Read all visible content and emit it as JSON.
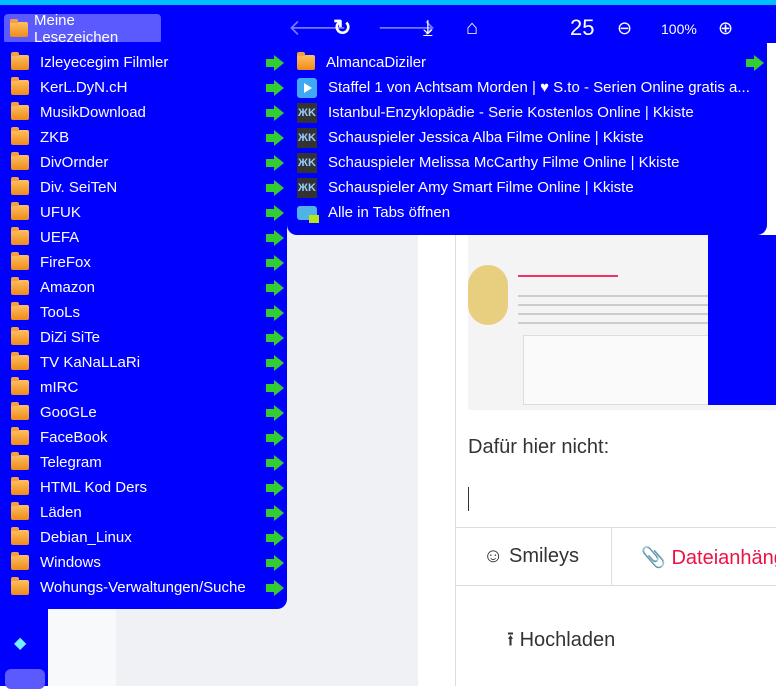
{
  "toolbar": {
    "bookmarks_label": "Meine Lesezeichen",
    "counter": "25",
    "zoom": "100%"
  },
  "colors": {
    "toolbar": "#0000ff",
    "accent_arrow": "#33cc33",
    "attach": "#ee1144"
  },
  "bookmarks": [
    {
      "label": "Izleyecegim Filmler"
    },
    {
      "label": "KerL.DyN.cH"
    },
    {
      "label": "MusikDownload"
    },
    {
      "label": "ZKB"
    },
    {
      "label": "DivOrnder"
    },
    {
      "label": "Div. SeiTeN"
    },
    {
      "label": "UFUK"
    },
    {
      "label": "UEFA"
    },
    {
      "label": "FireFox"
    },
    {
      "label": "Amazon"
    },
    {
      "label": "TooLs"
    },
    {
      "label": "DiZi SiTe"
    },
    {
      "label": "TV KaNaLLaRi"
    },
    {
      "label": "mIRC"
    },
    {
      "label": "GooGLe"
    },
    {
      "label": "FaceBook"
    },
    {
      "label": "Telegram"
    },
    {
      "label": "HTML Kod Ders"
    },
    {
      "label": "Läden"
    },
    {
      "label": "Debian_Linux"
    },
    {
      "label": "Windows"
    },
    {
      "label": "Wohungs-Verwaltungen/Suche"
    }
  ],
  "submenu": {
    "folder": "AlmancaDiziler",
    "links": [
      {
        "label": "Staffel 1 von Achtsam Morden | ♥ S.to - Serien Online gratis a...",
        "icon": "play"
      },
      {
        "label": "Istanbul-Enzyklopädie - Serie Kostenlos Online | Kkiste",
        "icon": "kk"
      },
      {
        "label": "Schauspieler Jessica Alba Filme Online | Kkiste",
        "icon": "kk"
      },
      {
        "label": "Schauspieler Melissa McCarthy Filme Online | Kkiste",
        "icon": "kk"
      },
      {
        "label": "Schauspieler Amy Smart Filme Online | Kkiste",
        "icon": "kk"
      }
    ],
    "open_all": "Alle in Tabs öffnen"
  },
  "content": {
    "heading": "Dafür hier nicht:",
    "smileys": "Smileys",
    "attachments": "Dateianhänge",
    "upload": "Hochladen"
  }
}
